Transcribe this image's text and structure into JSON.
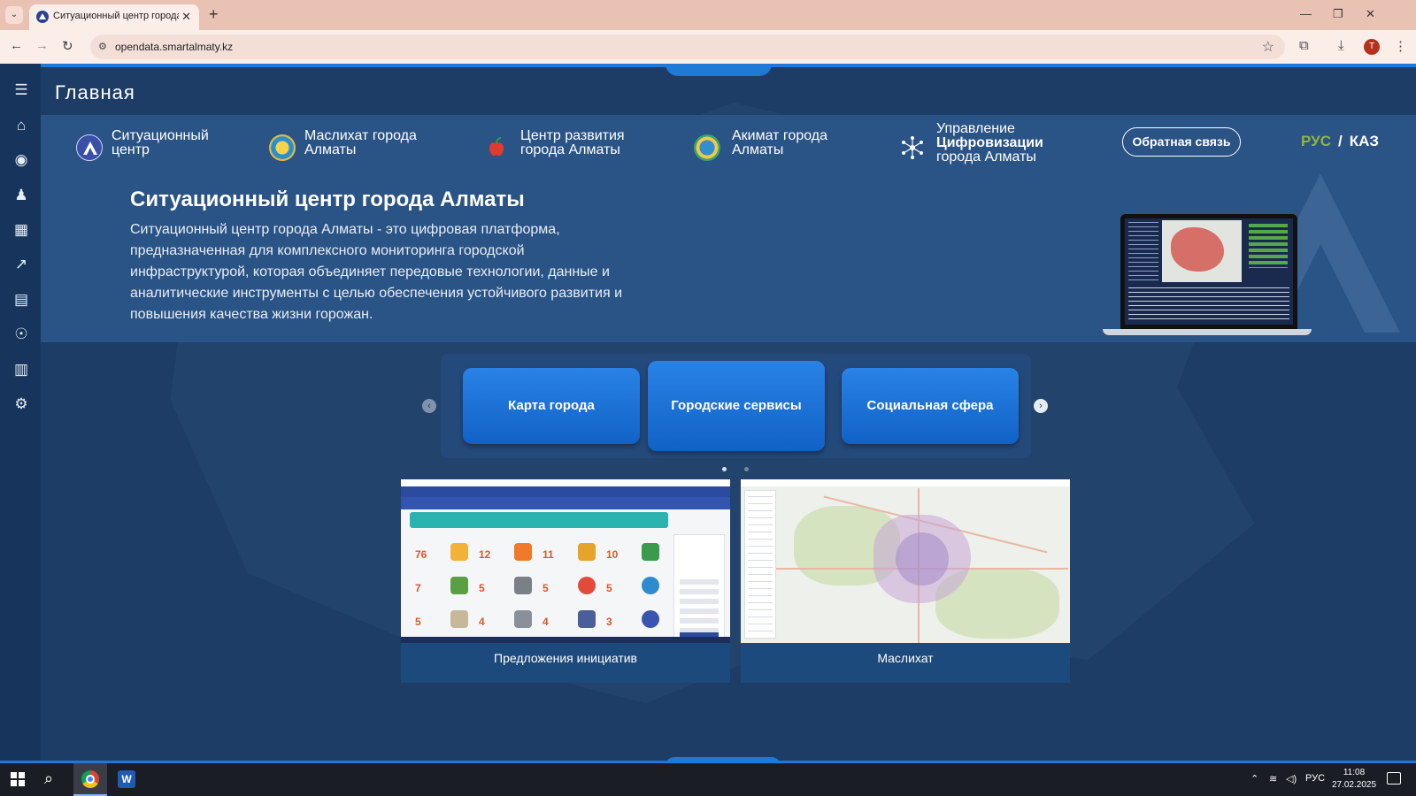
{
  "browser": {
    "tab_title": "Ситуационный центр города Алматы",
    "url": "opendata.smartalmaty.kz",
    "profile_initial": "T"
  },
  "page": {
    "title": "Главная",
    "partners": [
      {
        "line1": "Ситуационный",
        "line2": "центр",
        "logo": "situational-center-logo"
      },
      {
        "line1": "Маслихат города",
        "line2": "Алматы",
        "logo": "maslikhat-emblem"
      },
      {
        "line1": "Центр развития",
        "line2": "города Алматы",
        "logo": "apple-logo"
      },
      {
        "line1": "Акимат города",
        "line2": "Алматы",
        "logo": "akimat-emblem"
      },
      {
        "line1": "Управление",
        "line2": "Цифровизации",
        "line3": "города Алматы",
        "logo": "digitalization-logo"
      }
    ],
    "feedback_label": "Обратная связь",
    "lang": {
      "rus": "РУС",
      "separator": "/",
      "kaz": "КАЗ"
    },
    "hero": {
      "title": "Ситуационный центр города Алматы",
      "description": "Ситуационный центр города Алматы - это цифровая платформа, предназначенная для комплексного мониторинга городской инфраструктурой, которая объединяет передовые технологии, данные и аналитические инструменты с целью обеспечения устойчивого развития и повышения качества жизни горожан."
    },
    "services": [
      "Карта города",
      "Городские сервисы",
      "Социальная сфера"
    ],
    "cards": [
      {
        "label": "Предложения инициатив"
      },
      {
        "label": "Маслихат"
      }
    ],
    "initiatives_thumb": {
      "numbers": [
        "76",
        "12",
        "11",
        "10",
        "7",
        "5",
        "5",
        "5",
        "5",
        "4",
        "4",
        "3"
      ]
    }
  },
  "taskbar": {
    "lang": "РУС",
    "time": "11:08",
    "date": "27.02.2025"
  },
  "colors": {
    "accent": "#1e7ad6",
    "lang_active": "#8fb63f",
    "hero_bg": "#2a5386"
  }
}
